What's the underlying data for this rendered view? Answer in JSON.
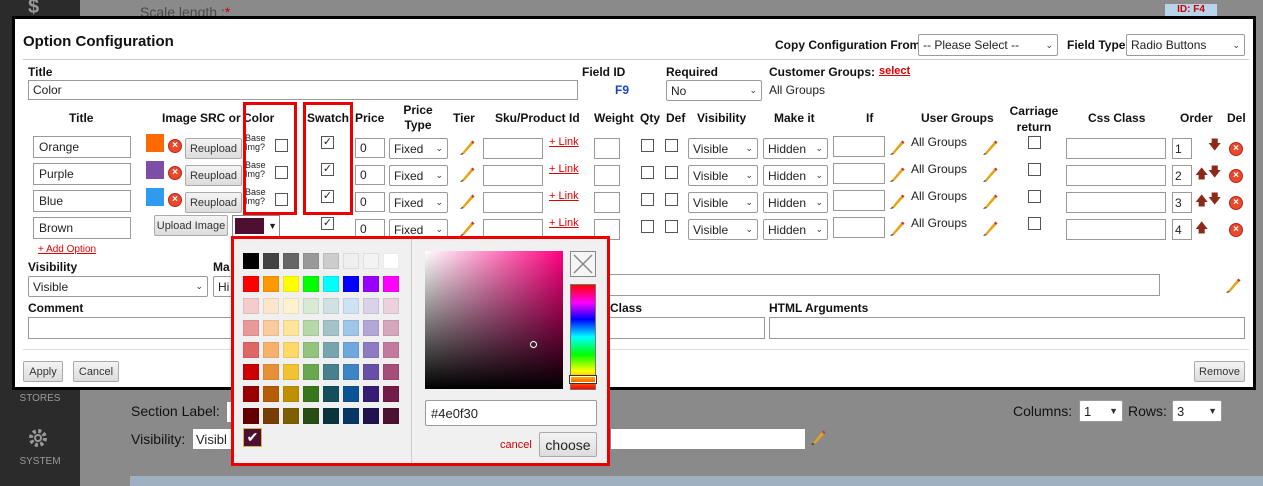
{
  "background": {
    "top_field": "Scale length :",
    "top_required": "*",
    "top_id": "ID: F4",
    "section_label": "Section Label:",
    "visibility": "Visibility:",
    "visibility_value": "Visibl",
    "columns": "Columns:",
    "columns_value": "1",
    "rows": "Rows:",
    "rows_value": "3",
    "stores": "STORES",
    "system": "SYSTEM",
    "dollar": "$"
  },
  "modal": {
    "title": "Option Configuration",
    "copy_label": "Copy Configuration From:",
    "copy_value": "-- Please Select --",
    "field_type_label": "Field Type:",
    "field_type_value": "Radio Buttons",
    "title_label": "Title",
    "title_value": "Color",
    "field_id_label": "Field ID",
    "field_id_value": "F9",
    "required_label": "Required",
    "required_value": "No",
    "customer_groups_label": "Customer Groups:",
    "customer_groups_select": "select",
    "customer_groups_value": "All Groups",
    "headers": {
      "title": "Title",
      "image": "Image SRC or",
      "color": "Color",
      "swatch": "Swatch",
      "price": "Price",
      "price_type": "Price Type",
      "tier": "Tier",
      "sku": "Sku/Product Id",
      "weight": "Weight",
      "qty": "Qty",
      "def": "Def",
      "visibility": "Visibility",
      "make_it": "Make it",
      "if": "If",
      "user_groups": "User Groups",
      "carriage": "Carriage return",
      "css": "Css Class",
      "order": "Order",
      "del": "Del"
    },
    "base_img": "Base Img?",
    "reupload": "Reupload",
    "upload_image": "Upload Image",
    "link": "+ Link",
    "options": [
      {
        "title": "Orange",
        "color": "#ff6a00",
        "price": "0",
        "price_type": "Fixed",
        "visibility": "Visible",
        "make_it": "Hidden",
        "user_groups": "All Groups",
        "order": "1"
      },
      {
        "title": "Purple",
        "color": "#7d4ea6",
        "price": "0",
        "price_type": "Fixed",
        "visibility": "Visible",
        "make_it": "Hidden",
        "user_groups": "All Groups",
        "order": "2"
      },
      {
        "title": "Blue",
        "color": "#2e9bf0",
        "price": "0",
        "price_type": "Fixed",
        "visibility": "Visible",
        "make_it": "Hidden",
        "user_groups": "All Groups",
        "order": "3"
      },
      {
        "title": "Brown",
        "color": "#4e0f30",
        "price": "0",
        "price_type": "Fixed",
        "visibility": "Visible",
        "make_it": "Hidden",
        "user_groups": "All Groups",
        "order": "4"
      }
    ],
    "add_option": "+ Add Option",
    "visibility_label": "Visibility",
    "visibility_value": "Visible",
    "make_label": "Ma",
    "make_value": "Hi",
    "comment_label": "Comment",
    "class_label": "Class",
    "html_args_label": "HTML Arguments",
    "apply": "Apply",
    "cancel": "Cancel",
    "remove": "Remove"
  },
  "picker": {
    "hex_value": "#4e0f30",
    "cancel": "cancel",
    "choose": "choose",
    "selected_check": "✔"
  },
  "colors": {
    "accent_red": "#e00000",
    "field_id_blue": "#1a3fd6"
  }
}
